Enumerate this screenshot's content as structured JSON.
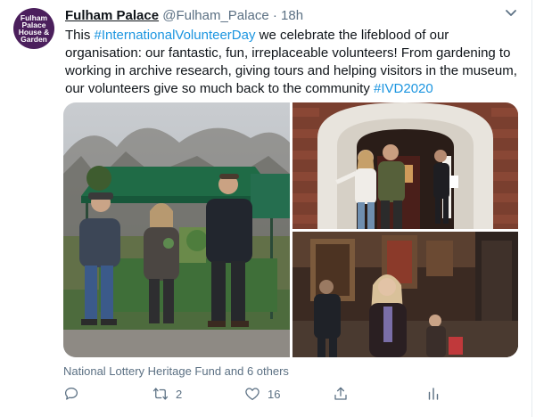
{
  "tweet": {
    "avatar_lines": [
      "Fulham",
      "Palace",
      "House &",
      "Garden"
    ],
    "display_name": "Fulham Palace",
    "handle": "@Fulham_Palace",
    "separator": "·",
    "time": "18h",
    "text_lines": [
      {
        "before": "This ",
        "link": "#InternationalVolunteerDay",
        "after": " we celebrate the lifeblood of our"
      },
      {
        "before": "organisation: our fantastic, fun, irreplaceable volunteers! From gardening to",
        "link": "",
        "after": ""
      },
      {
        "before": "working in archive research, giving tours and helping visitors in the museum,",
        "link": "",
        "after": ""
      },
      {
        "before": "our volunteers give so much back to the community ",
        "link": "#IVD2020",
        "after": ""
      }
    ],
    "tagged": "National Lottery Heritage Fund and 6 others",
    "actions": {
      "reply": {
        "icon": "reply-icon",
        "count": ""
      },
      "retweet": {
        "icon": "retweet-icon",
        "count": "2"
      },
      "like": {
        "icon": "heart-icon",
        "count": "16"
      },
      "share": {
        "icon": "share-icon",
        "count": ""
      }
    },
    "colors": {
      "accent": "#1b95e0",
      "muted": "#5b7083",
      "brand_avatar": "#4b1f5c"
    }
  }
}
